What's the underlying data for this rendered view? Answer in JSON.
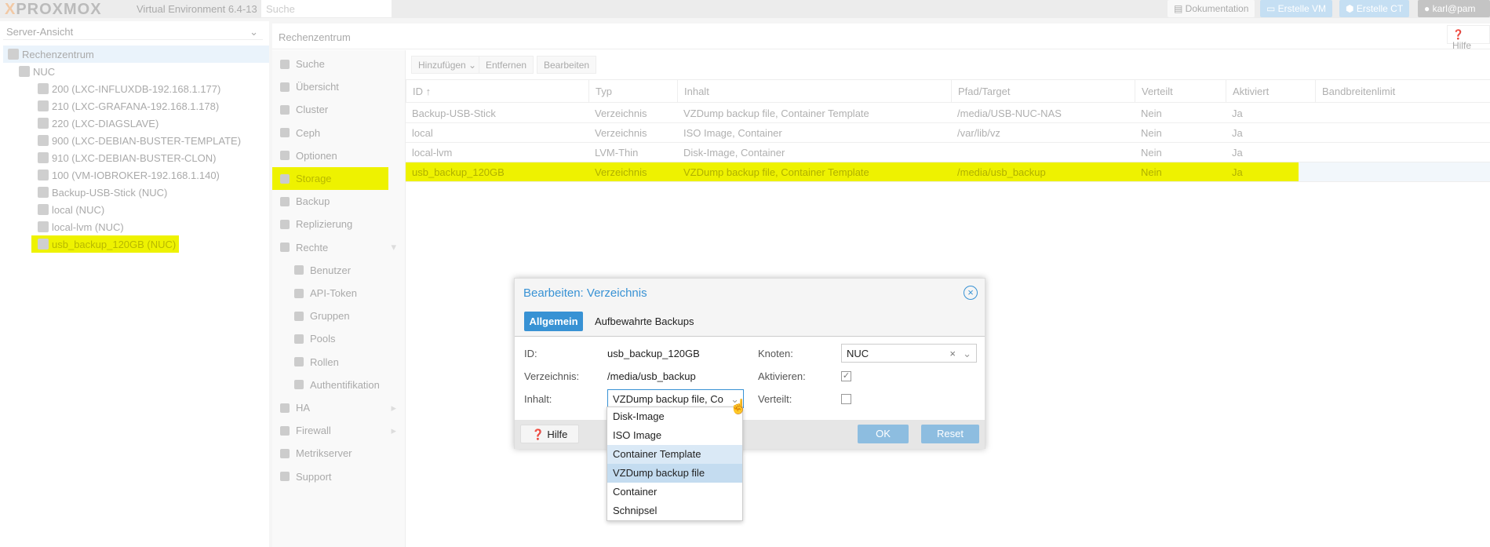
{
  "topbar": {
    "brand": "PROXMOX",
    "version": "Virtual Environment 6.4-13",
    "search_placeholder": "Suche",
    "docs": "Dokumentation",
    "create_vm": "Erstelle VM",
    "create_ct": "Erstelle CT",
    "user": "karl@pam"
  },
  "tree": {
    "view": "Server-Ansicht",
    "items": [
      "Rechenzentrum",
      "NUC",
      "200 (LXC-INFLUXDB-192.168.1.177)",
      "210 (LXC-GRAFANA-192.168.1.178)",
      "220 (LXC-DIAGSLAVE)",
      "900 (LXC-DEBIAN-BUSTER-TEMPLATE)",
      "910 (LXC-DEBIAN-BUSTER-CLON)",
      "100 (VM-IOBROKER-192.168.1.140)",
      "Backup-USB-Stick (NUC)",
      "local (NUC)",
      "local-lvm (NUC)",
      "usb_backup_120GB (NUC)"
    ]
  },
  "center": {
    "title": "Rechenzentrum",
    "help": "Hilfe"
  },
  "nav": [
    "Suche",
    "Übersicht",
    "Cluster",
    "Ceph",
    "Optionen",
    "Storage",
    "Backup",
    "Replizierung",
    "Rechte",
    "Benutzer",
    "API-Token",
    "Gruppen",
    "Pools",
    "Rollen",
    "Authentifikation",
    "HA",
    "Firewall",
    "Metrikserver",
    "Support"
  ],
  "toolbar": {
    "add": "Hinzufügen",
    "remove": "Entfernen",
    "edit": "Bearbeiten"
  },
  "grid": {
    "columns": [
      "ID ↑",
      "Typ",
      "Inhalt",
      "Pfad/Target",
      "Verteilt",
      "Aktiviert",
      "Bandbreitenlimit"
    ],
    "rows": [
      [
        "Backup-USB-Stick",
        "Verzeichnis",
        "VZDump backup file, Container Template",
        "/media/USB-NUC-NAS",
        "Nein",
        "Ja",
        ""
      ],
      [
        "local",
        "Verzeichnis",
        "ISO Image, Container",
        "/var/lib/vz",
        "Nein",
        "Ja",
        ""
      ],
      [
        "local-lvm",
        "LVM-Thin",
        "Disk-Image, Container",
        "",
        "Nein",
        "Ja",
        ""
      ],
      [
        "usb_backup_120GB",
        "Verzeichnis",
        "VZDump backup file, Container Template",
        "/media/usb_backup",
        "Nein",
        "Ja",
        ""
      ]
    ]
  },
  "dialog": {
    "title": "Bearbeiten: Verzeichnis",
    "tabs": [
      "Allgemein",
      "Aufbewahrte Backups"
    ],
    "id_label": "ID:",
    "id_value": "usb_backup_120GB",
    "dir_label": "Verzeichnis:",
    "dir_value": "/media/usb_backup",
    "content_label": "Inhalt:",
    "content_value": "VZDump backup file, Co",
    "node_label": "Knoten:",
    "node_value": "NUC",
    "enable_label": "Aktivieren:",
    "enabled": true,
    "shared_label": "Verteilt:",
    "shared": false,
    "help": "Hilfe",
    "ok": "OK",
    "reset": "Reset"
  },
  "dropdown": {
    "options": [
      "Disk-Image",
      "ISO Image",
      "Container Template",
      "VZDump backup file",
      "Container",
      "Schnipsel"
    ],
    "selected": [
      "Container Template",
      "VZDump backup file"
    ]
  },
  "colors": {
    "accent": "#3892d4",
    "highlight": "#eef200"
  }
}
